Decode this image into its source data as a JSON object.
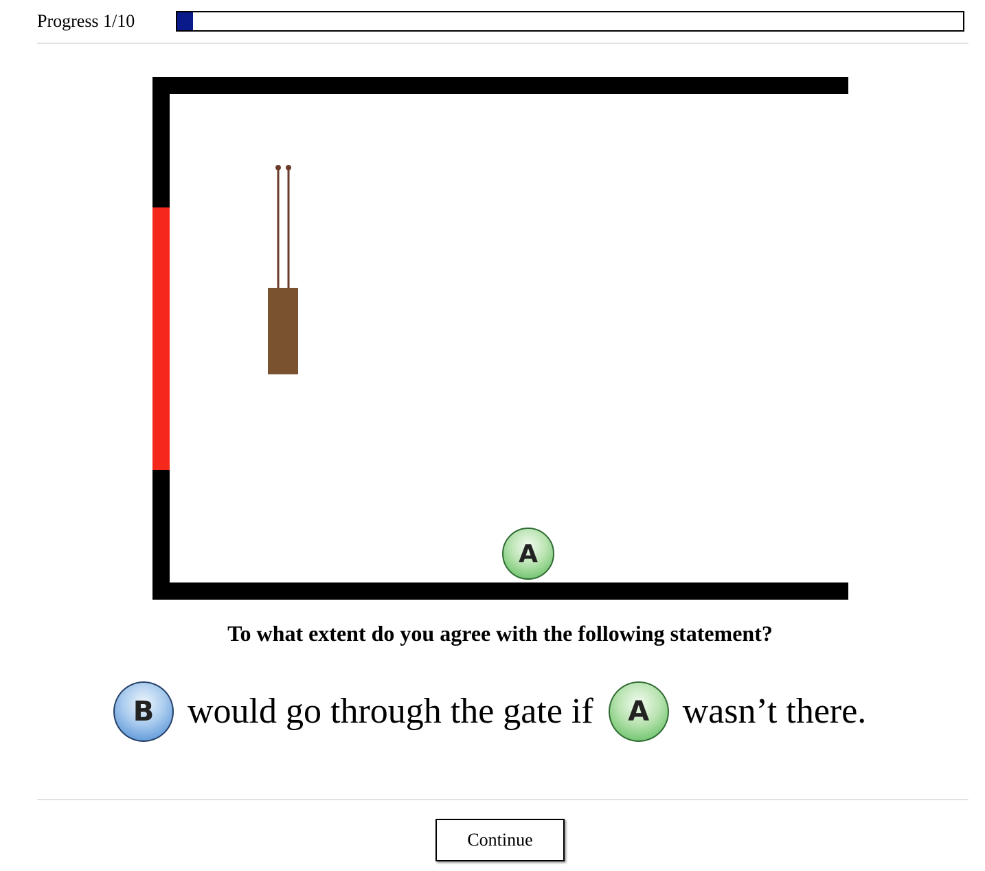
{
  "header": {
    "progress_label": "Progress 1/10",
    "progress_current": 1,
    "progress_total": 10,
    "progress_fraction": 0.02,
    "progress_color": "#0a1a8a"
  },
  "scene": {
    "goal_color": "#f5291b",
    "wall_color": "#000000",
    "box_color": "#7a5230",
    "rope_color": "#6b3a2a",
    "agent_a_label": "A",
    "agent_a_color": "#6cc36a"
  },
  "question": {
    "prompt": "To what extent do you agree with the following statement?",
    "statement": {
      "agent_b_label": "B",
      "part1": "would go through the gate if",
      "agent_a_label": "A",
      "part2": "wasn’t there."
    },
    "agent_b_color": "#5d97d8"
  },
  "footer": {
    "continue_label": "Continue"
  }
}
